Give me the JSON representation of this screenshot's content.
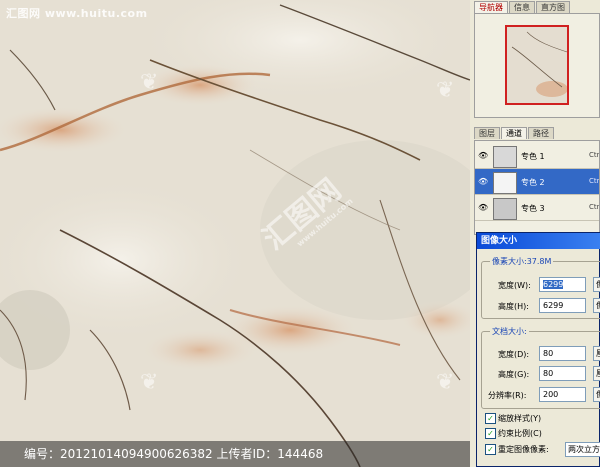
{
  "watermark": {
    "top_text": "汇图网 www.huitu.com",
    "bottom_text": "编号：20121014094900626382 上传者ID：144468",
    "logo_text": "汇图网",
    "logo_sub": "www.huitu.com"
  },
  "tabs_top": [
    {
      "label": "导航器"
    },
    {
      "label": "信息"
    },
    {
      "label": "直方图"
    }
  ],
  "tabs_bottom": [
    {
      "label": "图层"
    },
    {
      "label": "通道"
    },
    {
      "label": "路径"
    }
  ],
  "channels": [
    {
      "name": "专色 1",
      "shortcut": "Ctrl+"
    },
    {
      "name": "专色 2",
      "shortcut": "Ctrl+",
      "selected": true
    },
    {
      "name": "专色 3",
      "shortcut": "Ctrl+"
    }
  ],
  "dialog": {
    "title": "图像大小",
    "pixel_size_label": "像素大小:37.8M",
    "width_label": "宽度(W):",
    "width_value": "6299",
    "width_unit": "像",
    "height_label": "高度(H):",
    "height_value": "6299",
    "height_unit": "像",
    "doc_size_label": "文档大小:",
    "doc_width_label": "宽度(D):",
    "doc_width_value": "80",
    "doc_width_unit": "厘",
    "doc_height_label": "高度(G):",
    "doc_height_value": "80",
    "doc_height_unit": "厘",
    "resolution_label": "分辨率(R):",
    "resolution_value": "200",
    "resolution_unit": "像",
    "scale_styles_label": "缩放样式(Y)",
    "constrain_label": "约束比例(C)",
    "resample_label": "重定图像像素:",
    "resample_option": "两次立方"
  },
  "colors": {
    "selection": "#3369c6",
    "titlebar": "#0a4ad8",
    "nav_frame": "#d02020"
  }
}
